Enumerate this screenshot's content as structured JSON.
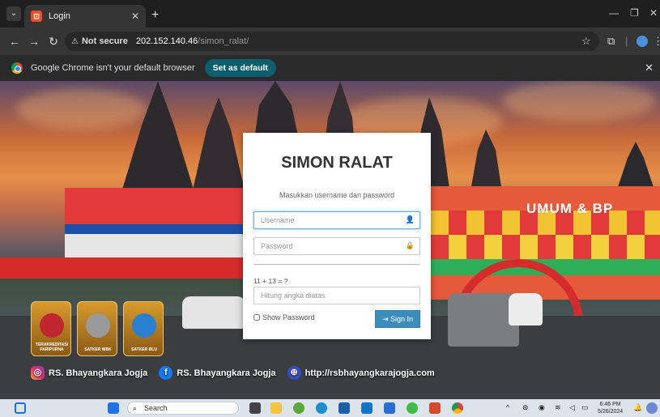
{
  "browser": {
    "tab_title": "Login",
    "tab_favicon": "⊡",
    "new_tab": "+",
    "url_warning": "Not secure",
    "url_host": "202.152.140.46",
    "url_path": "/simon_ralat/",
    "infobar_text": "Google Chrome isn't your default browser",
    "set_default_label": "Set as default"
  },
  "login": {
    "title": "SIMON RALAT",
    "subtitle": "Masukkan username dan password",
    "username_placeholder": "Username",
    "password_placeholder": "Password",
    "captcha_question": "11 + 13 = ?",
    "captcha_placeholder": "Hitung angka diatas",
    "show_password_label": "Show Password",
    "signin_label": "Sign In"
  },
  "background": {
    "building_sign": "UMUM & BP",
    "badges": [
      {
        "caption": "TERAKREDITASI PARIPURNA"
      },
      {
        "caption": "SATKER WBK"
      },
      {
        "caption": "SATKER BLU"
      }
    ],
    "social": [
      {
        "label": "RS. Bhayangkara Jogja",
        "icon": "instagram-icon"
      },
      {
        "label": "RS. Bhayangkara Jogja",
        "icon": "facebook-icon"
      },
      {
        "label": "http://rsbhayangkarajogja.com",
        "icon": "globe-icon"
      }
    ]
  },
  "taskbar": {
    "search_label": "Search",
    "time": "6:46 PM",
    "date": "5/26/2024"
  }
}
